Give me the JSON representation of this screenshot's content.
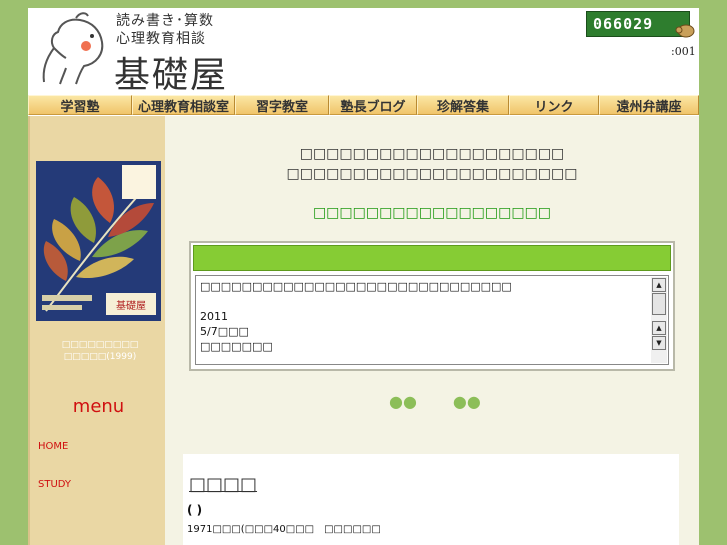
{
  "header": {
    "logo_line1": "読み書き･算数",
    "logo_line2": "心理教育相談",
    "logo_main": "基礎屋",
    "counter_value": "066029",
    "counter_sub": ":001"
  },
  "nav": {
    "items": [
      {
        "label": "学習塾"
      },
      {
        "label": "心理教育相談室"
      },
      {
        "label": "習字教室"
      },
      {
        "label": "塾長ブログ"
      },
      {
        "label": "珍解答集"
      },
      {
        "label": "リンク"
      },
      {
        "label": "遠州弁講座"
      }
    ]
  },
  "sidebar": {
    "book_cover_text": "基礎屋",
    "book_caption_line1": "□□□□□□□□□",
    "book_caption_line2": "□□□□□(1999)",
    "menu_heading": "menu",
    "links": [
      {
        "label": "HOME"
      },
      {
        "label": "STUDY"
      }
    ]
  },
  "main": {
    "line1": "□□□□□□□□□□□□□□□□□□□□",
    "line2": "□□□□□□□□□□□□□□□□□□□□□□",
    "green_line": "□□□□□□□□□□□□□□□□□□",
    "news": {
      "line1": "□□□□□□□□□□□□□□□□□□□□□□□□□□□□□□",
      "line2": "",
      "line3": "2011",
      "line4": "5/7□□□",
      "line5": "□□□□□□□"
    },
    "dots_left": "●●",
    "dots_right": "●●",
    "profile": {
      "title": "□□□□",
      "paren": "( )",
      "text": "1971□□□(□□□40□□□　□□□□□□"
    }
  }
}
